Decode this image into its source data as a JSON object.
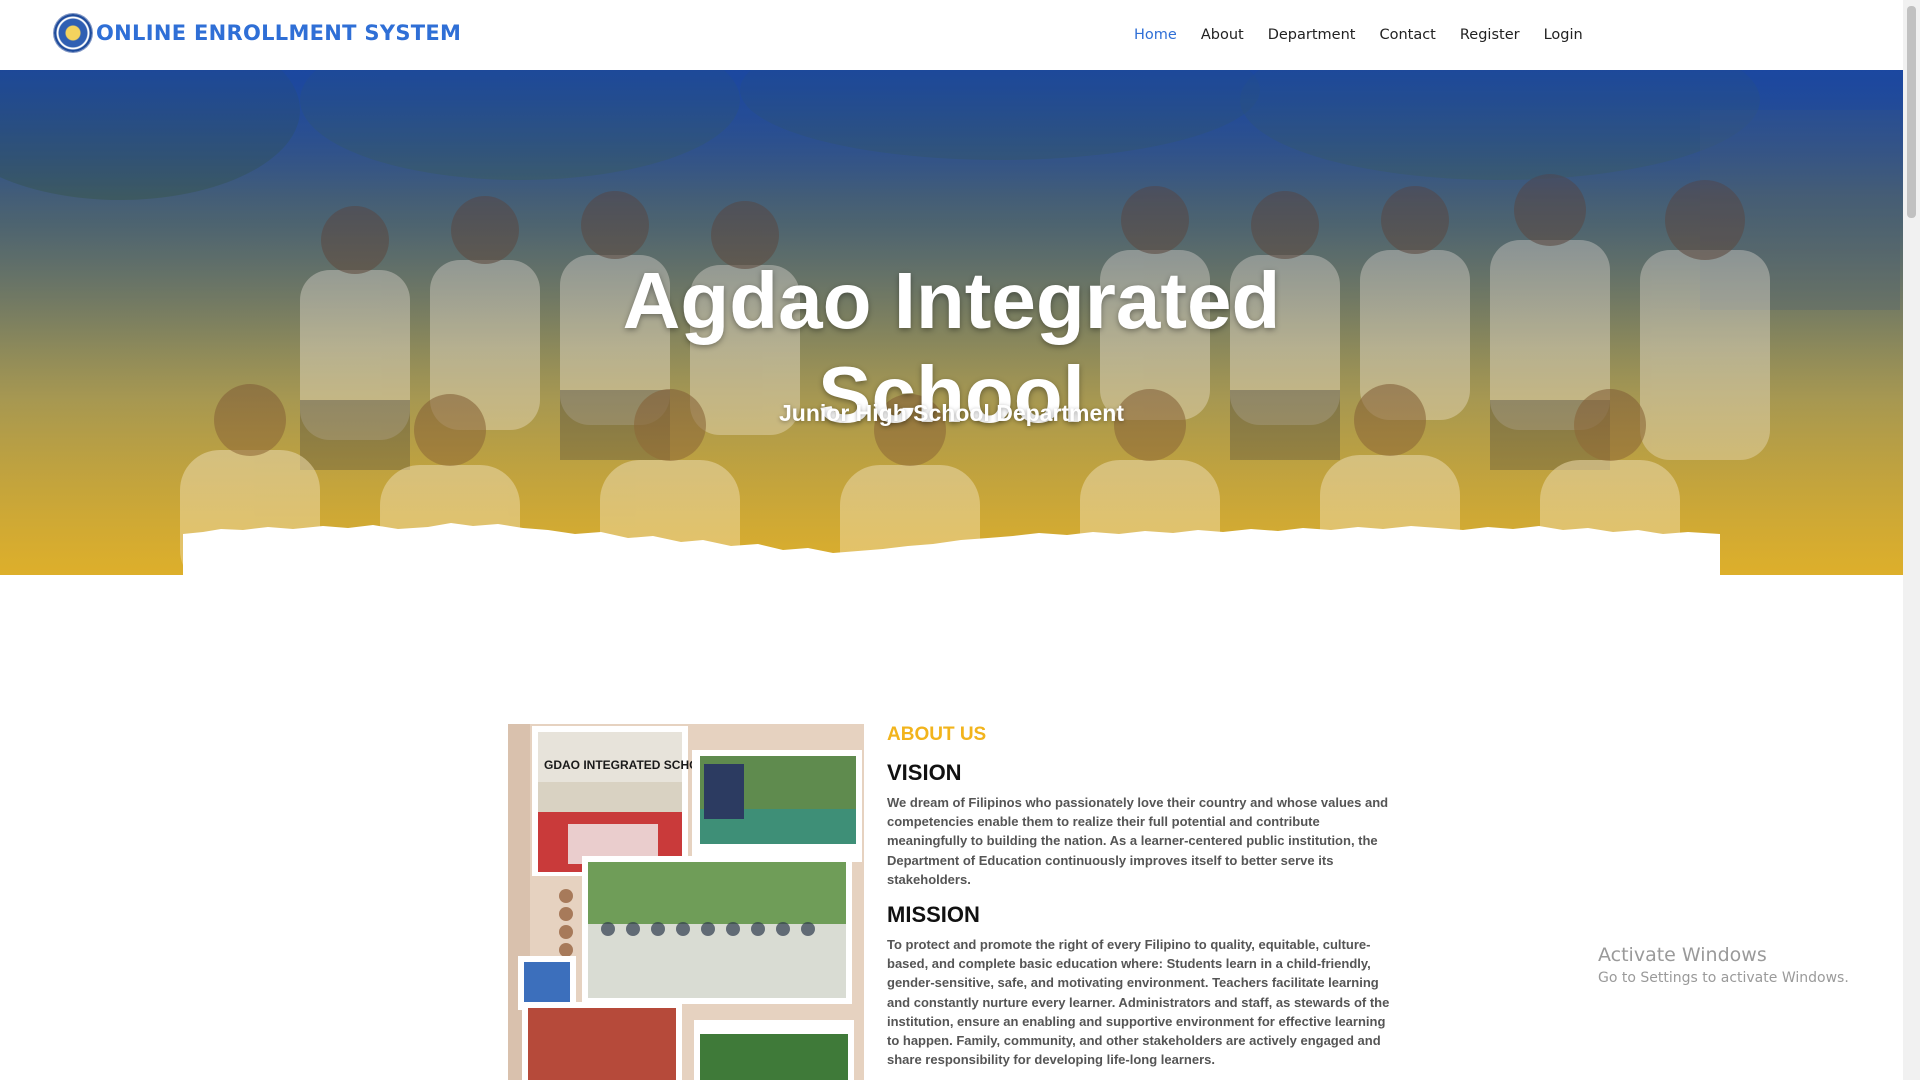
{
  "app": {
    "brand_title": "ONLINE ENROLLMENT SYSTEM",
    "logo_icon": "school-seal-icon",
    "accent_color": "#2f6fd6"
  },
  "nav": {
    "items": [
      {
        "label": "Home",
        "active": true
      },
      {
        "label": "About"
      },
      {
        "label": "Department"
      },
      {
        "label": "Contact"
      },
      {
        "label": "Register"
      },
      {
        "label": "Login"
      }
    ]
  },
  "hero": {
    "title_line1": "Agdao Integrated",
    "title_line2": "School",
    "subtitle": "Junior High School Department"
  },
  "about": {
    "kicker": "ABOUT US",
    "vision_heading": "VISION",
    "vision_text": "We dream of Filipinos who passionately love their country and whose values and competencies enable them to realize their full potential and contribute meaningfully to building the nation. As a learner-centered public institution, the Department of Education continuously improves itself to better serve its stakeholders.",
    "mission_heading": "MISSION",
    "mission_text": "To protect and promote the right of every Filipino to quality, equitable, culture-based, and complete basic education where: Students learn in a child-friendly, gender-sensitive, safe, and motivating environment. Teachers facilitate learning and constantly nurture every learner. Administrators and staff, as stewards of the institution, ensure an enabling and supportive environment for effective learning to happen. Family, community, and other stakeholders are actively engaged and share responsibility for developing life-long learners.",
    "collage_sign_text": "GDAO INTEGRATED SCHOOL",
    "kicker_color": "#f2b41c"
  },
  "watermark": {
    "title": "Activate Windows",
    "subtitle": "Go to Settings to activate Windows."
  }
}
